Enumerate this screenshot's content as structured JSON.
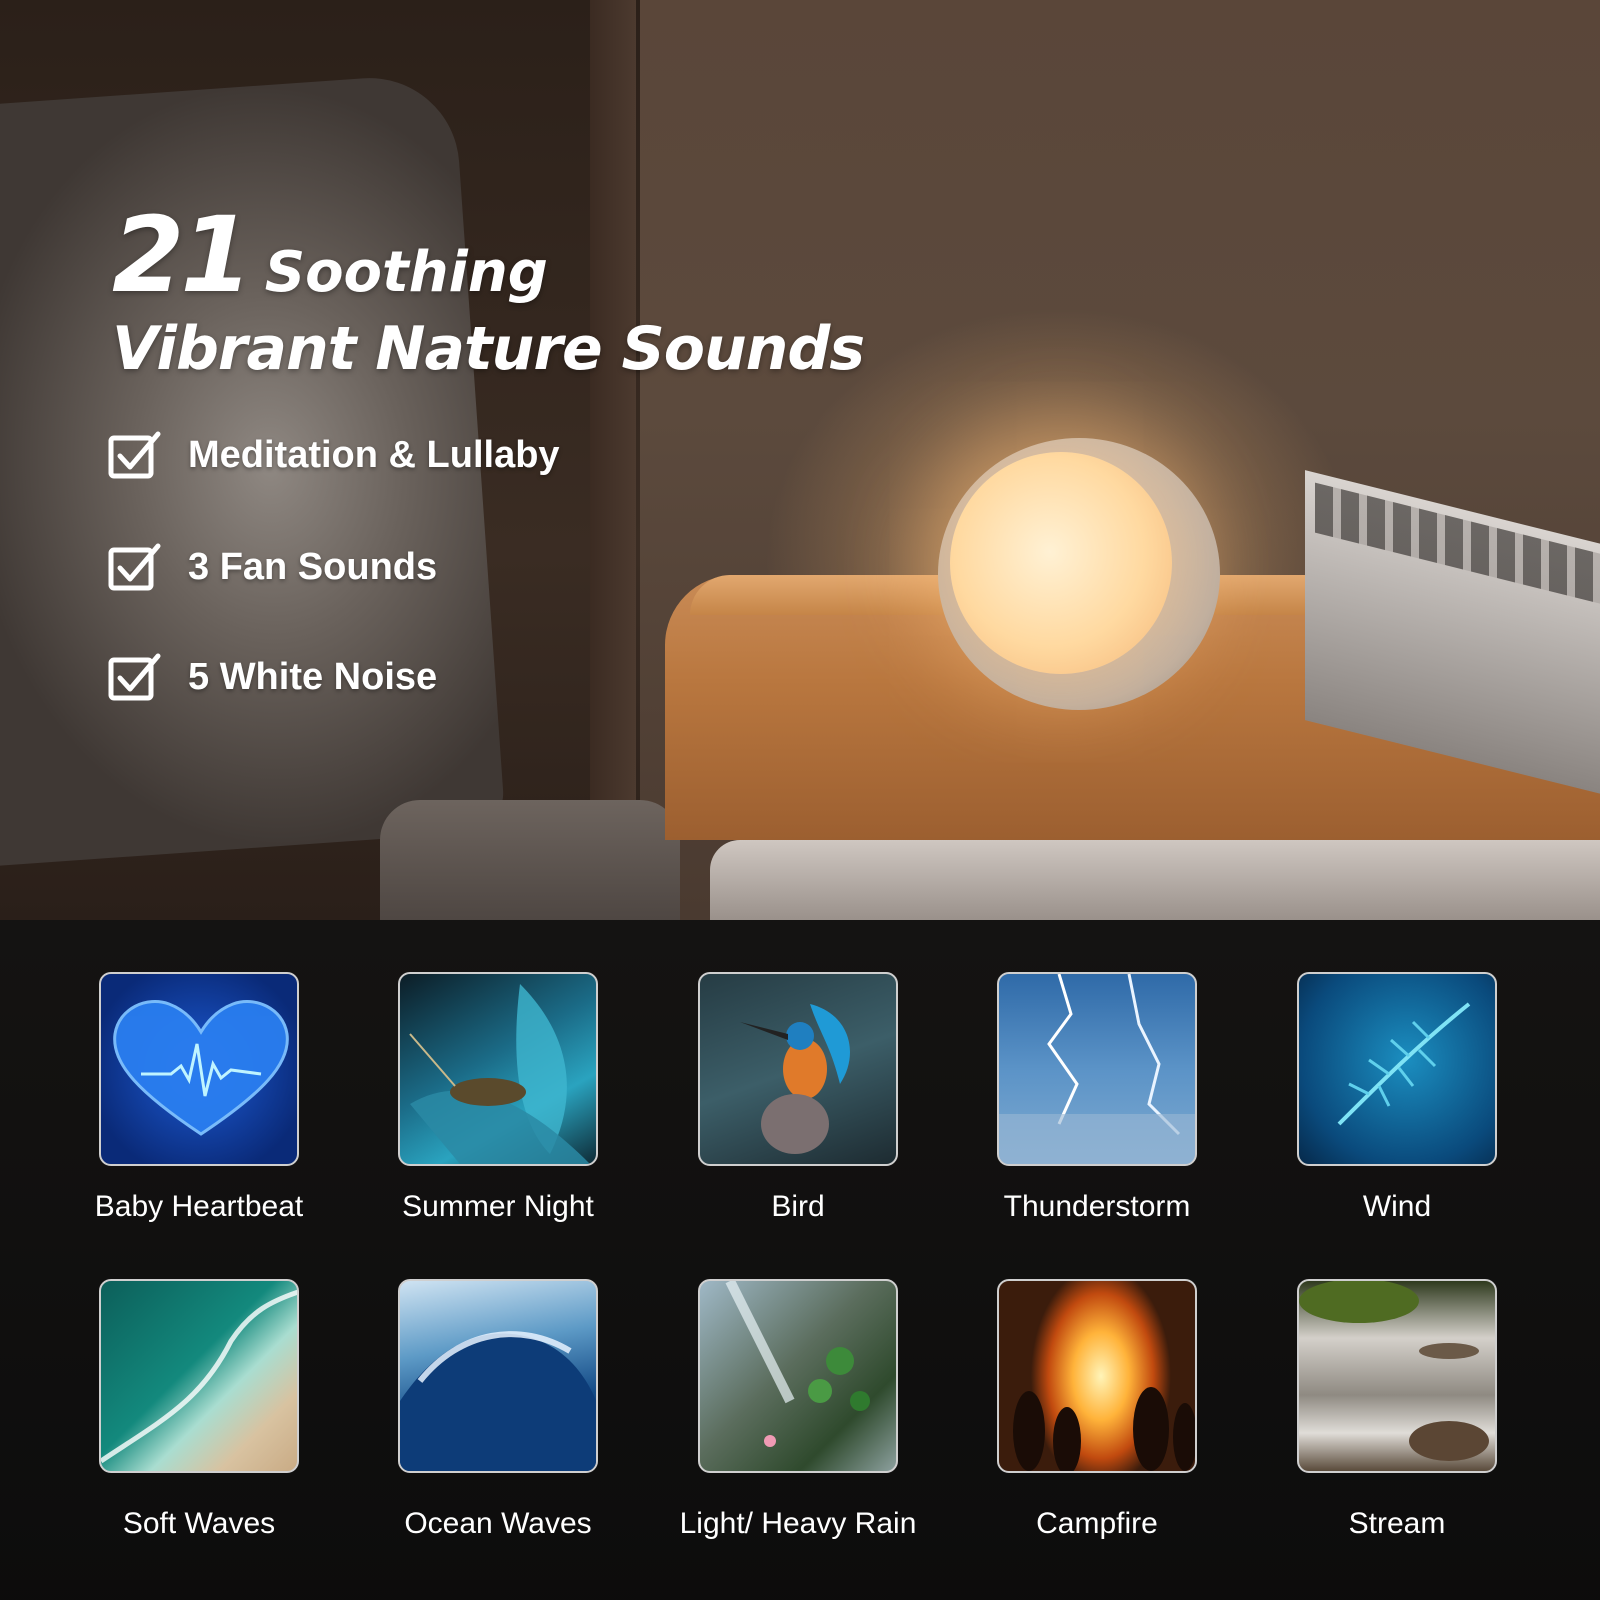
{
  "headline": {
    "number": "21",
    "word": "Soothing",
    "line2": "Vibrant Nature Sounds"
  },
  "features": [
    {
      "label": "Meditation & Lullaby"
    },
    {
      "label": "3 Fan Sounds"
    },
    {
      "label": "5 White Noise"
    }
  ],
  "sounds": [
    {
      "label": "Baby Heartbeat"
    },
    {
      "label": "Summer Night"
    },
    {
      "label": "Bird"
    },
    {
      "label": "Thunderstorm"
    },
    {
      "label": "Wind"
    },
    {
      "label": "Soft Waves"
    },
    {
      "label": "Ocean Waves"
    },
    {
      "label": "Light/ Heavy Rain"
    },
    {
      "label": "Campfire"
    },
    {
      "label": "Stream"
    }
  ],
  "colors": {
    "text": "#ffffff",
    "panel": "#141312",
    "lamp_glow": "#ffd9a0",
    "tile_border": "#cfcfcf"
  }
}
